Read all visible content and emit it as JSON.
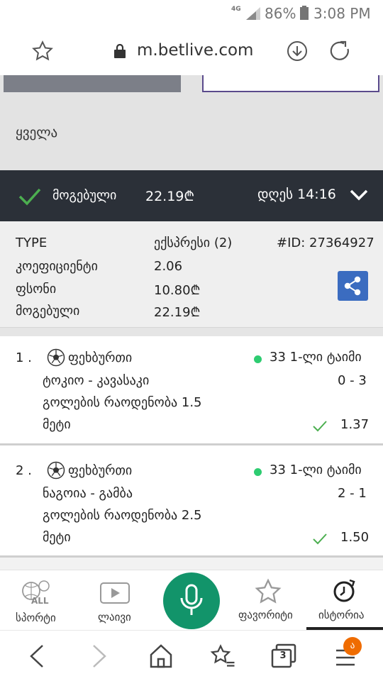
{
  "status_bar": {
    "network": "4G",
    "battery_pct": "86%",
    "time": "3:08 PM"
  },
  "browser": {
    "url": "m.betlive.com"
  },
  "filter": {
    "label": "ყველა"
  },
  "bet": {
    "status": "მოგებული",
    "amount": "22.19₾",
    "time": "დღეს 14:16",
    "status_color": "#4caf50"
  },
  "info": {
    "type_label": "TYPE",
    "type_value": "ექსპრესი (2)",
    "id": "#ID: 27364927",
    "coef_label": "კოეფიციენტი",
    "coef_value": "2.06",
    "stake_label": "ფსონი",
    "stake_value": "10.80₾",
    "win_label": "მოგებული",
    "win_value": "22.19₾"
  },
  "events": [
    {
      "index": "1 .",
      "sport": "ფეხბურთი",
      "period": "33 1-ლი ტაიმი",
      "teams": "ტოკიო - კავასაკი",
      "score": "0 - 3",
      "market": "გოლების რაოდენობა 1.5",
      "outcome": "მეტი",
      "odds": "1.37"
    },
    {
      "index": "2 .",
      "sport": "ფეხბურთი",
      "period": "33 1-ლი ტაიმი",
      "teams": "ნაგოია - გამბა",
      "score": "2 - 1",
      "market": "გოლების რაოდენობა 2.5",
      "outcome": "მეტი",
      "odds": "1.50"
    }
  ],
  "tab_nav": {
    "sports_icon_text": "ALL",
    "sports": "სპორტი",
    "live": "ლაივი",
    "favorites": "ფავორიტი",
    "history": "ისტორია"
  },
  "sys_nav": {
    "tabs_count": "3",
    "menu_badge": "ა"
  },
  "colors": {
    "header_bg": "#2b3038",
    "accent_green": "#12946a",
    "share_blue": "#3b6cc0",
    "badge_orange": "#ef6c00"
  }
}
